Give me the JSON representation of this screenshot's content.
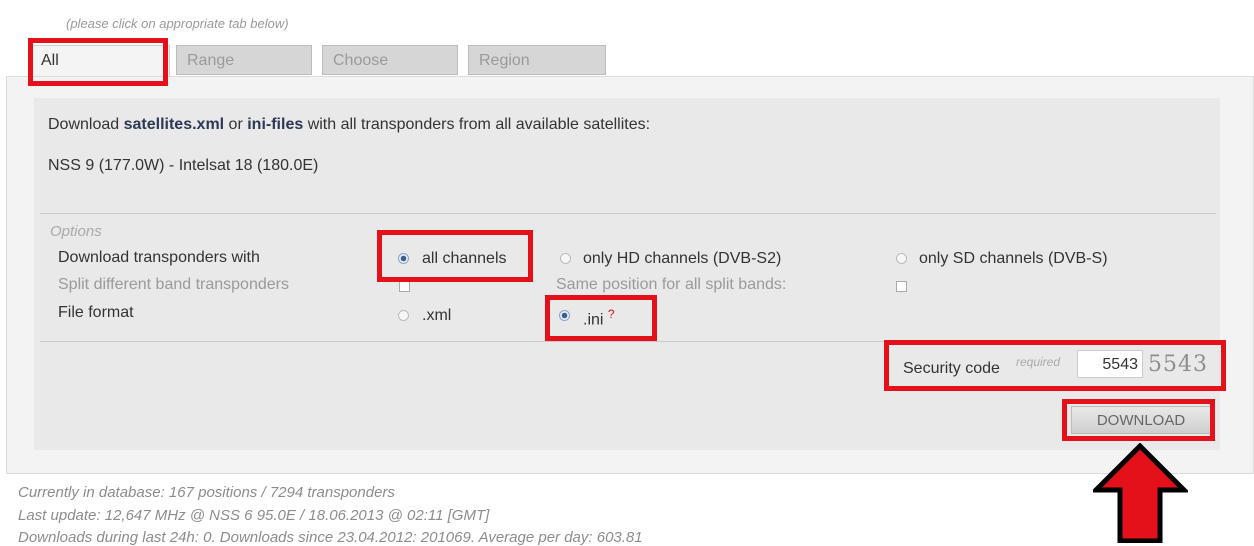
{
  "hint": "(please click on appropriate tab below)",
  "tabs": [
    {
      "label": "All",
      "active": true
    },
    {
      "label": "Range",
      "active": false
    },
    {
      "label": "Choose",
      "active": false
    },
    {
      "label": "Region",
      "active": false
    }
  ],
  "intro": {
    "prefix": "Download ",
    "link1": "satellites.xml",
    "mid": " or ",
    "link2": "ini-files",
    "suffix": " with all transponders from all available satellites:"
  },
  "range_text": "NSS 9 (177.0W) - Intelsat 18 (180.0E)",
  "options": {
    "title": "Options",
    "transponders_label": "Download transponders with",
    "choices": [
      "all channels",
      "only HD channels (DVB-S2)",
      "only SD channels (DVB-S)"
    ],
    "selected_choice": "all channels",
    "split_label": "Split different band transponders",
    "same_position_label": "Same position for all split bands:",
    "format_label": "File format",
    "formats": [
      ".xml",
      ".ini"
    ],
    "selected_format": ".ini",
    "ini_help": "?"
  },
  "security": {
    "label": "Security code",
    "required": "required",
    "value": "5543",
    "captcha": "5543"
  },
  "download_label": "DOWNLOAD",
  "footer": {
    "line1": "Currently in database: 167 positions / 7294 transponders",
    "line2": "Last update: 12,647 MHz @ NSS 6 95.0E / 18.06.2013 @ 02:11 [GMT]",
    "line3": "Downloads during last 24h: 0. Downloads since 23.04.2012: 201069. Average per day: 603.81"
  },
  "colors": {
    "highlight": "#e4111b",
    "arrow_fill": "#e4111b",
    "arrow_outline": "#000000"
  }
}
